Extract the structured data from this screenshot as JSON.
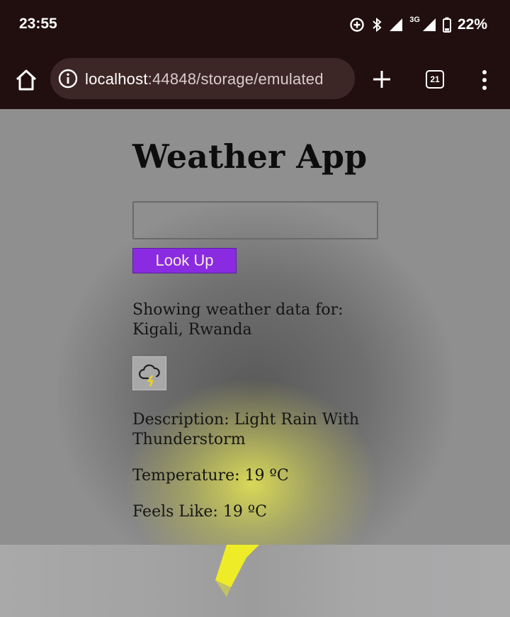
{
  "status_bar": {
    "time": "23:55",
    "network_label": "3G",
    "battery": "22%",
    "icons": [
      "data-saver-icon",
      "bluetooth-icon",
      "signal-icon",
      "signal-3g-icon",
      "battery-icon"
    ]
  },
  "browser": {
    "url_host": "localhost",
    "url_rest": ":44848/storage/emulated",
    "tab_count": "21",
    "icons": [
      "home-icon",
      "info-icon",
      "plus-icon",
      "tab-switcher-icon",
      "more-vert-icon"
    ]
  },
  "app": {
    "title": "Weather App",
    "search_value": "",
    "lookup_label": "Look Up",
    "showing_label": "Showing weather data for: Kigali, Rwanda",
    "weather_icon": "cloud-lightning-icon",
    "description": "Description: Light Rain With Thunderstorm",
    "temperature": "Temperature: 19 ºC",
    "feels_like": "Feels Like: 19 ºC"
  },
  "colors": {
    "chrome_bg": "#210f10",
    "url_pill_bg": "#3d2726",
    "button_bg": "#8a2be2",
    "button_text": "#f6eed6"
  }
}
